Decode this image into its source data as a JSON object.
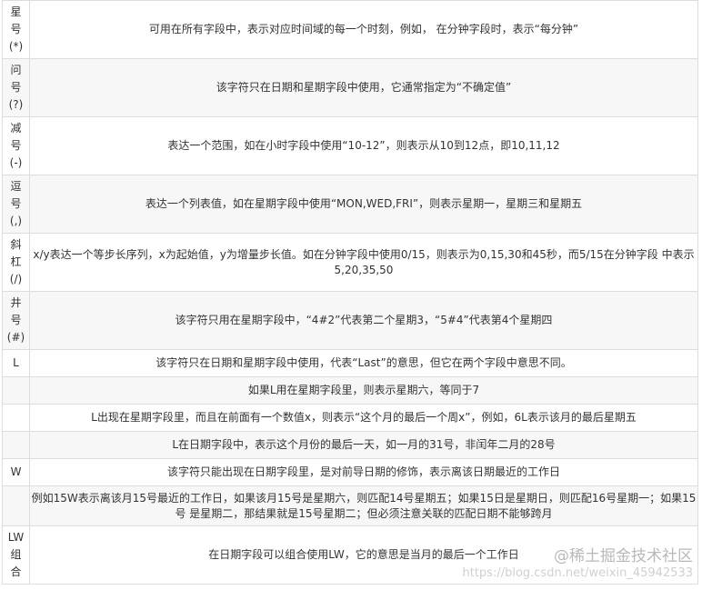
{
  "rows": [
    {
      "symbol": "星\n号\n(*)",
      "desc": "可用在所有字段中，表示对应时间域的每一个时刻，例如， 在分钟字段时，表示“每分钟”"
    },
    {
      "symbol": "问\n号\n(?)",
      "desc": "该字符只在日期和星期字段中使用，它通常指定为“不确定值”"
    },
    {
      "symbol": "减\n号\n(-)",
      "desc": "表达一个范围，如在小时字段中使用“10-12”，则表示从10到12点，即10,11,12"
    },
    {
      "symbol": "逗\n号\n(,)",
      "desc": "表达一个列表值，如在星期字段中使用“MON,WED,FRI”，则表示星期一，星期三和星期五"
    },
    {
      "symbol": "斜\n杠\n(/)",
      "desc": "x/y表达一个等步长序列，x为起始值，y为增量步长值。如在分钟字段中使用0/15，则表示为0,15,30和45秒，而5/15在分钟字段 中表示5,20,35,50"
    },
    {
      "symbol": "井\n号\n(#)",
      "desc": "该字符只用在星期字段中，“4#2”代表第二个星期3，“5#4”代表第4个星期四"
    },
    {
      "symbol": "L",
      "desc": "该字符只在日期和星期字段中使用，代表“Last”的意思，但它在两个字段中意思不同。"
    },
    {
      "symbol": "",
      "desc": "如果L用在星期字段里，则表示星期六，等同于7"
    },
    {
      "symbol": "",
      "desc": "L出现在星期字段里，而且在前面有一个数值x，则表示“这个月的最后一个周x”，例如，6L表示该月的最后星期五"
    },
    {
      "symbol": "",
      "desc": "L在日期字段中，表示这个月份的最后一天，如一月的31号，非闰年二月的28号"
    },
    {
      "symbol": "W",
      "desc": "该字符只能出现在日期字段里，是对前导日期的修饰，表示离该日期最近的工作日"
    },
    {
      "symbol": "",
      "desc": "例如15W表示离该月15号最近的工作日，如果该月15号是星期六，则匹配14号星期五；如果15日是星期日，则匹配16号星期一；如果15号 是星期二，那结果就是15号星期二；但必须注意关联的匹配日期不能够跨月"
    },
    {
      "symbol": "LW\n组\n合",
      "desc": "在日期字段可以组合使用LW，它的意思是当月的最后一个工作日"
    }
  ],
  "watermark": {
    "title": "@稀土掘金技术社区",
    "url": "https://blog.csdn.net/weixin_45942533"
  }
}
